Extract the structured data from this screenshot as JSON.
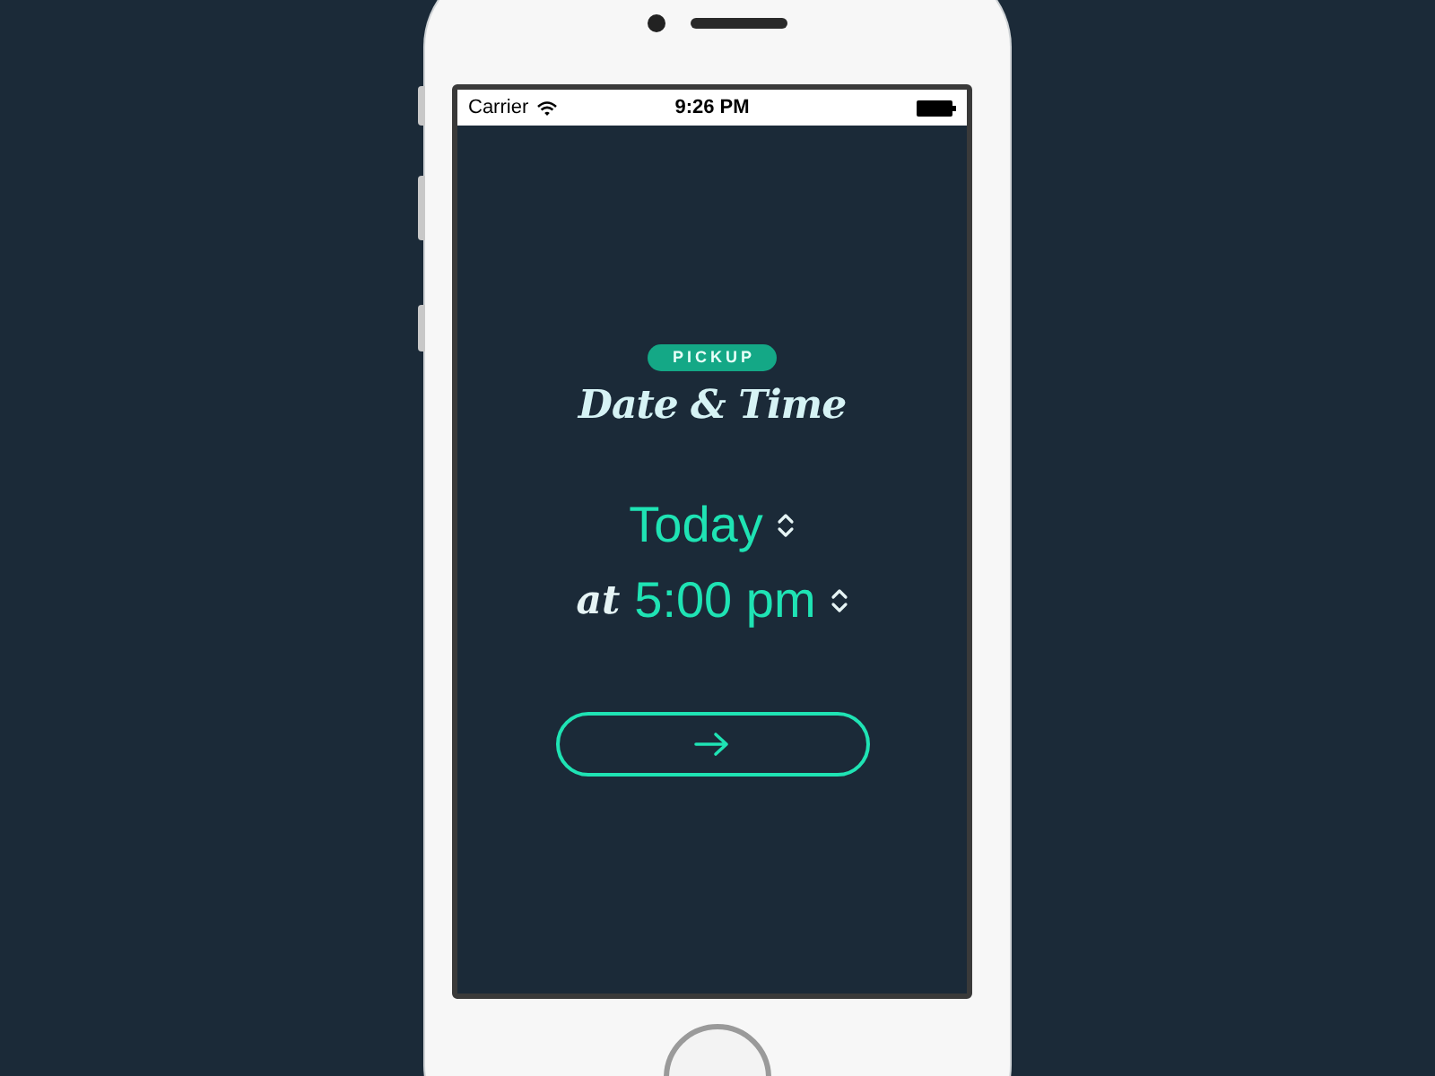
{
  "status_bar": {
    "carrier": "Carrier",
    "time": "9:26 PM"
  },
  "badge": "PICKUP",
  "title": "Date & Time",
  "date": {
    "value": "Today"
  },
  "time": {
    "prefix": "at",
    "value": "5:00 pm"
  }
}
